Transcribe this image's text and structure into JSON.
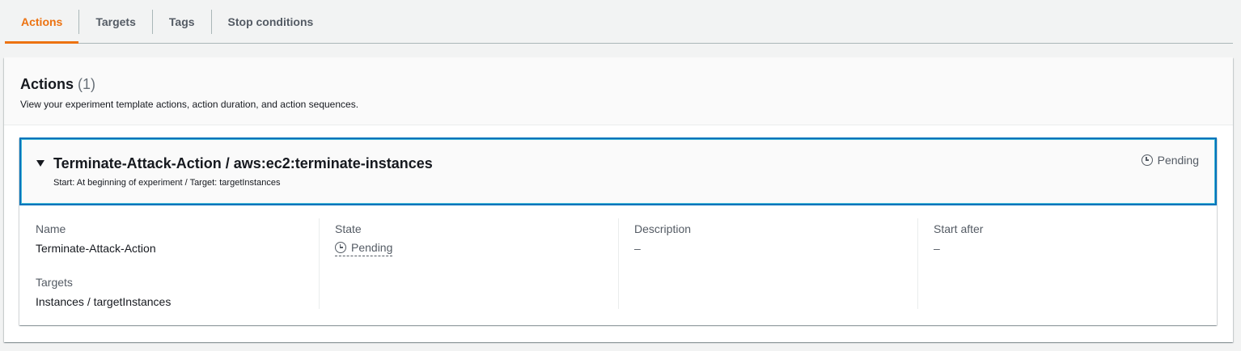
{
  "tabs": [
    {
      "label": "Actions",
      "active": true
    },
    {
      "label": "Targets",
      "active": false
    },
    {
      "label": "Tags",
      "active": false
    },
    {
      "label": "Stop conditions",
      "active": false
    }
  ],
  "container": {
    "title": "Actions",
    "count": "(1)",
    "description": "View your experiment template actions, action duration, and action sequences."
  },
  "action": {
    "title": "Terminate-Attack-Action / aws:ec2:terminate-instances",
    "subtitle": "Start: At beginning of experiment / Target: targetInstances",
    "status": "Pending",
    "status_icon": "clock-icon"
  },
  "details": {
    "name_label": "Name",
    "name_value": "Terminate-Attack-Action",
    "targets_label": "Targets",
    "targets_value": "Instances / targetInstances",
    "state_label": "State",
    "state_value": "Pending",
    "description_label": "Description",
    "description_value": "–",
    "start_after_label": "Start after",
    "start_after_value": "–"
  },
  "colors": {
    "accent": "#ec7211",
    "focus_border": "#0073bb",
    "text": "#16191f",
    "muted": "#545b64"
  }
}
